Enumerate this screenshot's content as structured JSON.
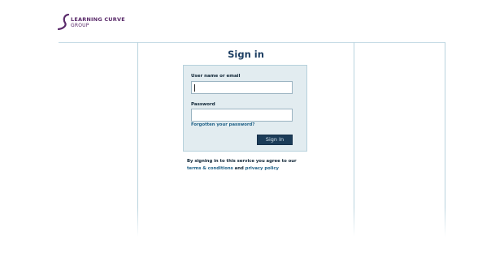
{
  "logo": {
    "line1": "LEARNING CURVE",
    "line2": "GROUP"
  },
  "page": {
    "title": "Sign in"
  },
  "form": {
    "username_label": "User name or email",
    "username_value": "",
    "password_label": "Password",
    "password_value": "",
    "forgot_label": "Forgotten your password?",
    "submit_label": "Sign In"
  },
  "footer": {
    "agree_text": "By signing in to this service you agree to our",
    "terms_label": "terms & conditions",
    "and_text": "and",
    "privacy_label": "privacy policy"
  },
  "colors": {
    "brand": "#5a2a6a",
    "heading": "#1e3f63",
    "link": "#1f6187",
    "button": "#1c3c58",
    "panel": "#e2ecf0"
  }
}
